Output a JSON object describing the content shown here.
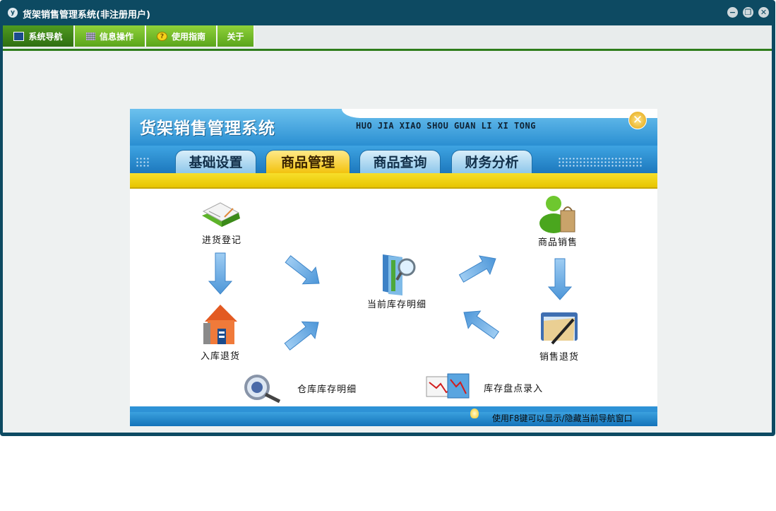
{
  "window": {
    "app_icon": "y",
    "title": "货架销售管理系统(非注册用户)",
    "buttons": {
      "minimize": "−",
      "restore": "❐",
      "close": "✕"
    }
  },
  "menubar": {
    "items": [
      {
        "label": "系统导航",
        "icon": "monitor-icon",
        "active": true
      },
      {
        "label": "信息操作",
        "icon": "grid-icon",
        "active": false
      },
      {
        "label": "使用指南",
        "icon": "help-icon",
        "active": false
      },
      {
        "label": "关于",
        "icon": "",
        "active": false
      }
    ]
  },
  "nav_panel": {
    "title": "货架销售管理系统",
    "pinyin": "HUO JIA XIAO SHOU GUAN LI XI TONG",
    "close_glyph": "✕",
    "tabs": [
      {
        "label": "基础设置",
        "active": false
      },
      {
        "label": "商品管理",
        "active": true
      },
      {
        "label": "商品查询",
        "active": false
      },
      {
        "label": "财务分析",
        "active": false
      }
    ],
    "nodes": {
      "purchase_register": "进货登记",
      "warehouse_return": "入库退货",
      "current_stock": "当前库存明细",
      "product_sales": "商品销售",
      "sales_return": "销售退货",
      "warehouse_stock": "仓库库存明细",
      "inventory_check": "库存盘点录入"
    },
    "footer_hint": "使用F8键可以显示/隐藏当前导航窗口"
  },
  "colors": {
    "window_frame": "#0d4a62",
    "menu_green": "#6fb82a",
    "header_blue": "#2a8fd2",
    "active_tab": "#f2c10a",
    "arrow_blue": "#6aaee6"
  }
}
